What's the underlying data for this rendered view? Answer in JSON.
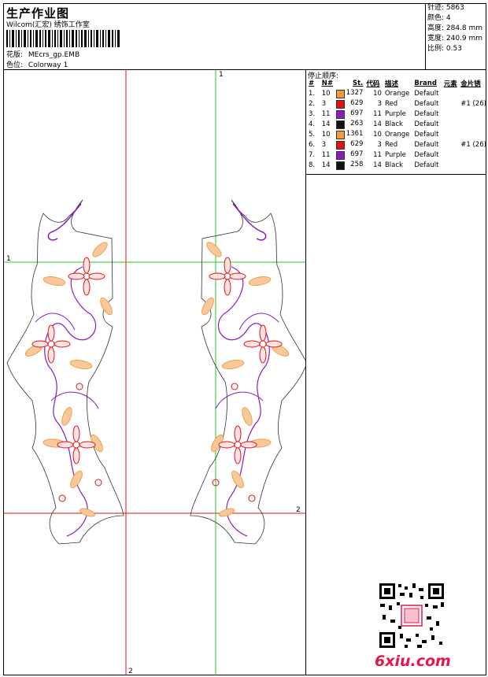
{
  "header": {
    "title": "生产作业图",
    "subtitle": "Wilcom(汇宏) 绣饰工作室",
    "pattern_label": "花版:",
    "pattern_value": "MEcrs_gp.EMB",
    "colorway_label": "色位:",
    "colorway_value": "Colorway 1"
  },
  "stats": {
    "stitches": "针迹: 5863",
    "colors": "颜色: 4",
    "height": "高度: 284.8 mm",
    "width": "宽度: 240.9 mm",
    "scale": "比例: 0.53"
  },
  "stop_sequence": {
    "title": "停止顺序:",
    "headers": [
      "#",
      "N#",
      "St.",
      "代码",
      "描述",
      "Brand",
      "元素",
      "金片锈"
    ],
    "rows": [
      {
        "idx": "1.",
        "n": "10",
        "color": "#f39a3e",
        "st": "1327",
        "code": "10",
        "desc": "Orange",
        "brand": "Default",
        "elem": "",
        "seq": ""
      },
      {
        "idx": "2.",
        "n": "3",
        "color": "#e01212",
        "st": "629",
        "code": "3",
        "desc": "Red",
        "brand": "Default",
        "elem": "",
        "seq": "#1 (26)"
      },
      {
        "idx": "3.",
        "n": "11",
        "color": "#8a1bc2",
        "st": "697",
        "code": "11",
        "desc": "Purple",
        "brand": "Default",
        "elem": "",
        "seq": ""
      },
      {
        "idx": "4.",
        "n": "14",
        "color": "#111111",
        "st": "263",
        "code": "14",
        "desc": "Black",
        "brand": "Default",
        "elem": "",
        "seq": ""
      },
      {
        "idx": "5.",
        "n": "10",
        "color": "#f39a3e",
        "st": "1361",
        "code": "10",
        "desc": "Orange",
        "brand": "Default",
        "elem": "",
        "seq": ""
      },
      {
        "idx": "6.",
        "n": "3",
        "color": "#e01212",
        "st": "629",
        "code": "3",
        "desc": "Red",
        "brand": "Default",
        "elem": "",
        "seq": "#1 (26)"
      },
      {
        "idx": "7.",
        "n": "11",
        "color": "#8a1bc2",
        "st": "697",
        "code": "11",
        "desc": "Purple",
        "brand": "Default",
        "elem": "",
        "seq": ""
      },
      {
        "idx": "8.",
        "n": "14",
        "color": "#111111",
        "st": "258",
        "code": "14",
        "desc": "Black",
        "brand": "Default",
        "elem": "",
        "seq": ""
      }
    ]
  },
  "guides": {
    "v1": "1",
    "h1": "1",
    "v2": "2",
    "h2": "2"
  },
  "brand": "6xiu.com",
  "colors": {
    "guide_red": "#e01212",
    "guide_green": "#22cc22",
    "orange": "#f39a3e",
    "purple": "#8a1bc2",
    "red": "#e01212"
  }
}
